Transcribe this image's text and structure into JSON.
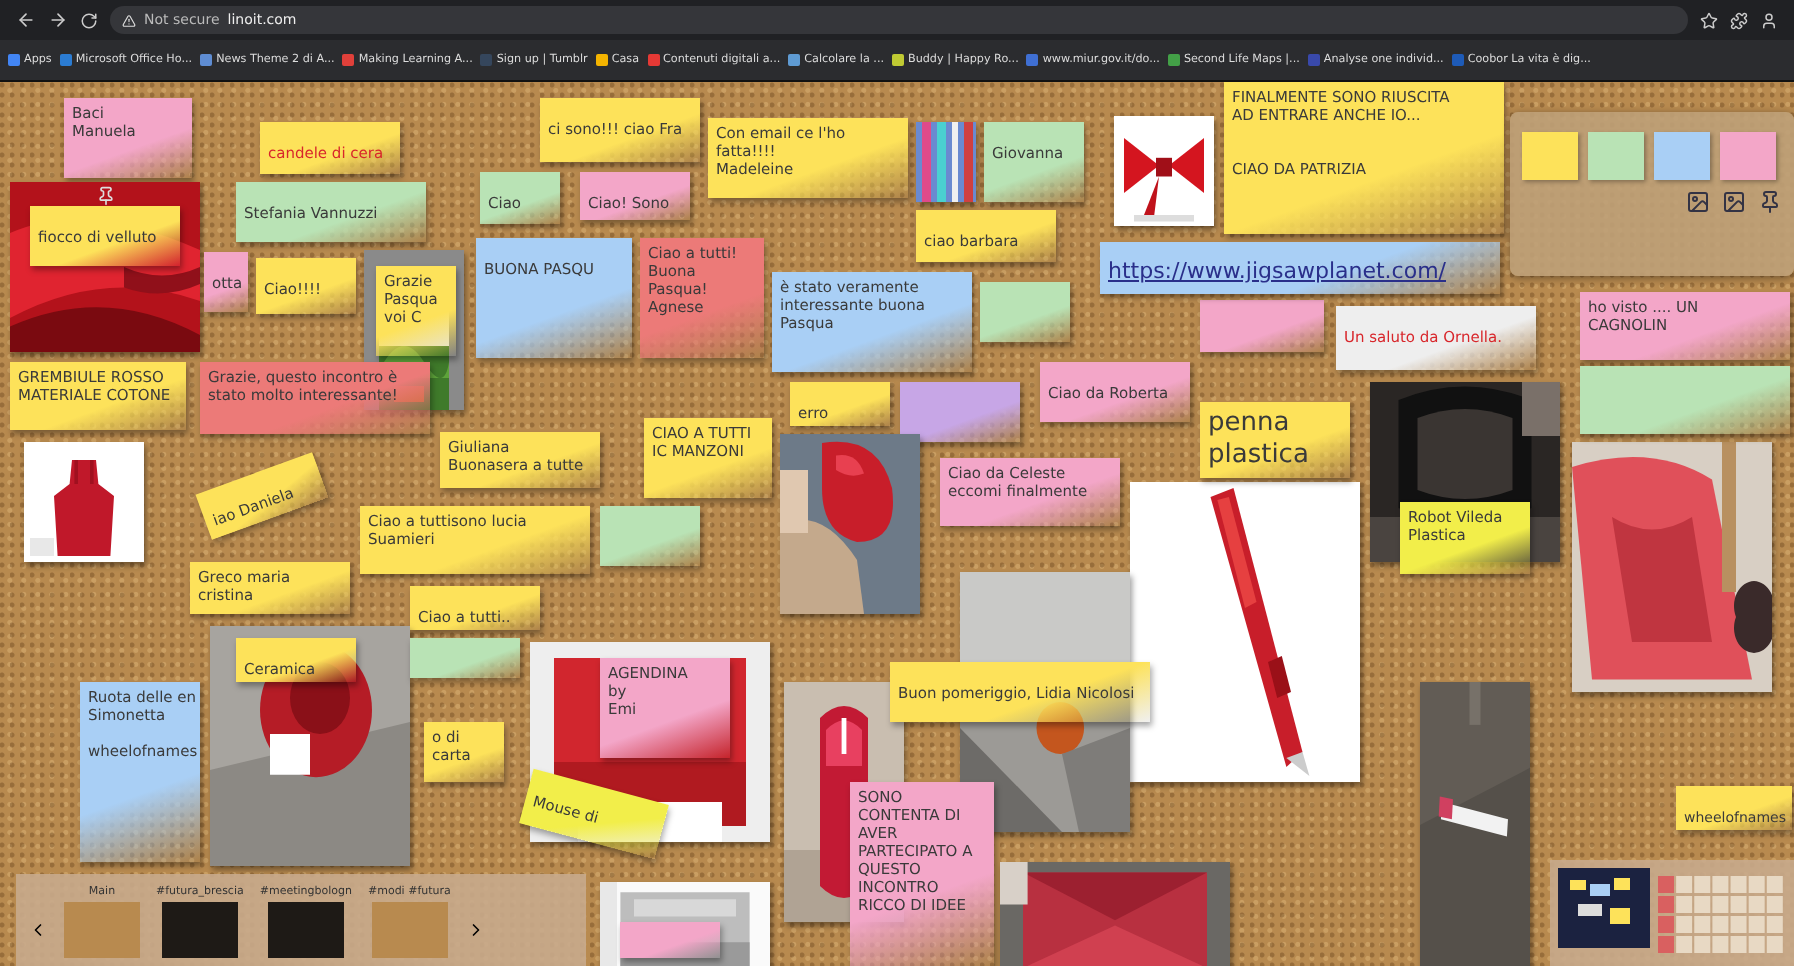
{
  "browser": {
    "security": "Not secure",
    "url": "linoit.com",
    "bookmarks": [
      {
        "label": "Apps",
        "color": "#4285f4"
      },
      {
        "label": "Microsoft Office Ho...",
        "color": "#2b7cd3"
      },
      {
        "label": "News Theme 2 di A...",
        "color": "#5f8dd3"
      },
      {
        "label": "Making Learning A...",
        "color": "#e0403a"
      },
      {
        "label": "Sign up | Tumblr",
        "color": "#35465c"
      },
      {
        "label": "Casa",
        "color": "#f4b400"
      },
      {
        "label": "Contenuti digitali a...",
        "color": "#e53935"
      },
      {
        "label": "Calcolare la ...",
        "color": "#5f9bd3"
      },
      {
        "label": "Buddy | Happy Ro...",
        "color": "#c0ca33"
      },
      {
        "label": "www.miur.gov.it/do...",
        "color": "#3f6fd3"
      },
      {
        "label": "Second Life Maps |...",
        "color": "#43a047"
      },
      {
        "label": "Analyse one individ...",
        "color": "#3949ab"
      },
      {
        "label": "Coobor La vita è dig...",
        "color": "#1e5bb8"
      }
    ]
  },
  "board": {
    "items": [
      {
        "kind": "note",
        "color": "#f3a6c8",
        "text": "Baci\nManuela"
      },
      {
        "kind": "note",
        "color": "#fde25a",
        "text": "candele di cera",
        "red_text": true
      },
      {
        "kind": "note",
        "color": "#b9e3b5",
        "text": "Stefania Vannuzzi"
      },
      {
        "kind": "note",
        "color": "#fde25a",
        "text": "ci sono!!! ciao Fra"
      },
      {
        "kind": "note",
        "color": "#b9e3b5",
        "text": "Ciao"
      },
      {
        "kind": "note",
        "color": "#f3a6c8",
        "text": "Ciao! Sono"
      },
      {
        "kind": "picture"
      },
      {
        "kind": "note",
        "color": "#fde25a",
        "text": "fiocco di velluto"
      },
      {
        "kind": "note",
        "color": "#f3a6c8",
        "text": "otta"
      },
      {
        "kind": "note",
        "color": "#fde25a",
        "text": "Ciao!!!!"
      },
      {
        "kind": "picture"
      },
      {
        "kind": "note",
        "color": "#fde25a",
        "text": "Grazie\nPasqua\nvoi C"
      },
      {
        "kind": "note",
        "color": "#fde25a",
        "text": "Con email ce l'ho fatta!!!!\nMadeleine"
      },
      {
        "kind": "picture"
      },
      {
        "kind": "note",
        "color": "#b9e3b5",
        "text": "Giovanna"
      },
      {
        "kind": "note",
        "color": "#fde25a",
        "text": "ciao barbara"
      },
      {
        "kind": "note",
        "color": "#a9cff5",
        "text": "BUONA PASQU"
      },
      {
        "kind": "note",
        "color": "#ec7a78",
        "text": "Ciao a tutti!\nBuona Pasqua!\nAgnese"
      },
      {
        "kind": "note",
        "color": "#a9cff5",
        "text": "è stato veramente interessante buona Pasqua"
      },
      {
        "kind": "note",
        "color": "#b9e3b5"
      },
      {
        "kind": "note",
        "color": "#f3a6c8"
      },
      {
        "kind": "note",
        "color": "#fde25a",
        "text": "GREMBIULE ROSSO\nMATERIALE COTONE"
      },
      {
        "kind": "note",
        "color": "#ec7a78",
        "text": "Grazie, questo incontro è stato molto interessante!"
      },
      {
        "kind": "note",
        "color": "#f3a6c8",
        "text": "Ciao da Roberta"
      },
      {
        "kind": "picture"
      },
      {
        "kind": "note",
        "color": "#fde25a",
        "text": "Giuliana\nBuonasera a tutte"
      },
      {
        "kind": "note",
        "color": "#fde25a",
        "text": "CIAO A TUTTI\nIC MANZONI"
      },
      {
        "kind": "note",
        "color": "#fde25a",
        "text": "erro"
      },
      {
        "kind": "note",
        "color": "#c7a6e6"
      },
      {
        "kind": "picture"
      },
      {
        "kind": "note",
        "color": "#fde25a",
        "text": "iao Daniela"
      },
      {
        "kind": "note",
        "color": "#fde25a",
        "text": "Ciao a tuttisono lucia\nSuamieri"
      },
      {
        "kind": "note",
        "color": "#b9e3b5"
      },
      {
        "kind": "note",
        "color": "#fde25a",
        "text": "Greco maria cristina"
      },
      {
        "kind": "note",
        "color": "#fde25a",
        "text": "Ciao a tutti.."
      },
      {
        "kind": "note",
        "color": "#f3a6c8",
        "text": "Ciao da Celeste\neccomi finalmente"
      },
      {
        "kind": "picture"
      },
      {
        "kind": "note",
        "color": "#fde25a",
        "text": "Ceramica"
      },
      {
        "kind": "note",
        "color": "#b9e3b5"
      },
      {
        "kind": "note",
        "color": "#a9cff5",
        "text": "Ruota delle en\nSimonetta\n\nwheelofnames"
      },
      {
        "kind": "note",
        "color": "#fde25a",
        "text": "o di carta"
      },
      {
        "kind": "picture"
      },
      {
        "kind": "note",
        "color": "#f3a6c8",
        "text": "AGENDINA\nby\nEmi"
      },
      {
        "kind": "note",
        "color": "#f2ee4a",
        "text": "Mouse di"
      },
      {
        "kind": "picture"
      },
      {
        "kind": "picture"
      },
      {
        "kind": "picture"
      },
      {
        "kind": "note",
        "color": "#f3a6c8",
        "text": "SONO\nCONTENTA DI\nAVER\nPARTECIPATO A\nQUESTO\nINCONTRO\nRICCO DI IDEE"
      },
      {
        "kind": "note",
        "color": "#fde25a",
        "text": "Buon pomeriggio, Lidia Nicolosi"
      },
      {
        "kind": "picture"
      },
      {
        "kind": "picture"
      },
      {
        "kind": "picture"
      },
      {
        "kind": "note",
        "color": "#f2ee4a",
        "text": "Robot Vileda\nPlastica"
      },
      {
        "kind": "picture"
      },
      {
        "kind": "picture"
      },
      {
        "kind": "note",
        "color": "#fde25a",
        "text": "FINALMENTE SONO RIUSCITA\nAD ENTRARE ANCHE IO...\n\n\nCIAO DA PATRIZIA"
      },
      {
        "kind": "note",
        "color": "#fde25a",
        "text": "penna\nplastica"
      },
      {
        "kind": "note",
        "color": "#eeeeee",
        "text": "Un saluto da Ornella.",
        "red_text": true
      },
      {
        "kind": "note",
        "color": "#f3a6c8",
        "text": "ho visto .... UN CAGNOLIN"
      },
      {
        "kind": "note",
        "color": "#b9e3b5"
      },
      {
        "kind": "note",
        "color": "#a9cff5",
        "text": "https://www.jigsawplanet.com/",
        "link": true
      },
      {
        "kind": "note",
        "color": "#fde25a",
        "text": "wheelofnames"
      },
      {
        "kind": "picture"
      },
      {
        "kind": "note",
        "color": "#f3a6c8"
      }
    ]
  },
  "board_tabs": [
    {
      "label": "Main"
    },
    {
      "label": "#futura_brescia"
    },
    {
      "label": "#meetingbologn"
    },
    {
      "label": "#modi #futura"
    }
  ],
  "palette": {
    "pads": [
      {
        "color": "#fde25a"
      },
      {
        "color": "#b9e3b5"
      },
      {
        "color": "#a9cff5"
      },
      {
        "color": "#f3a6c8"
      }
    ]
  }
}
